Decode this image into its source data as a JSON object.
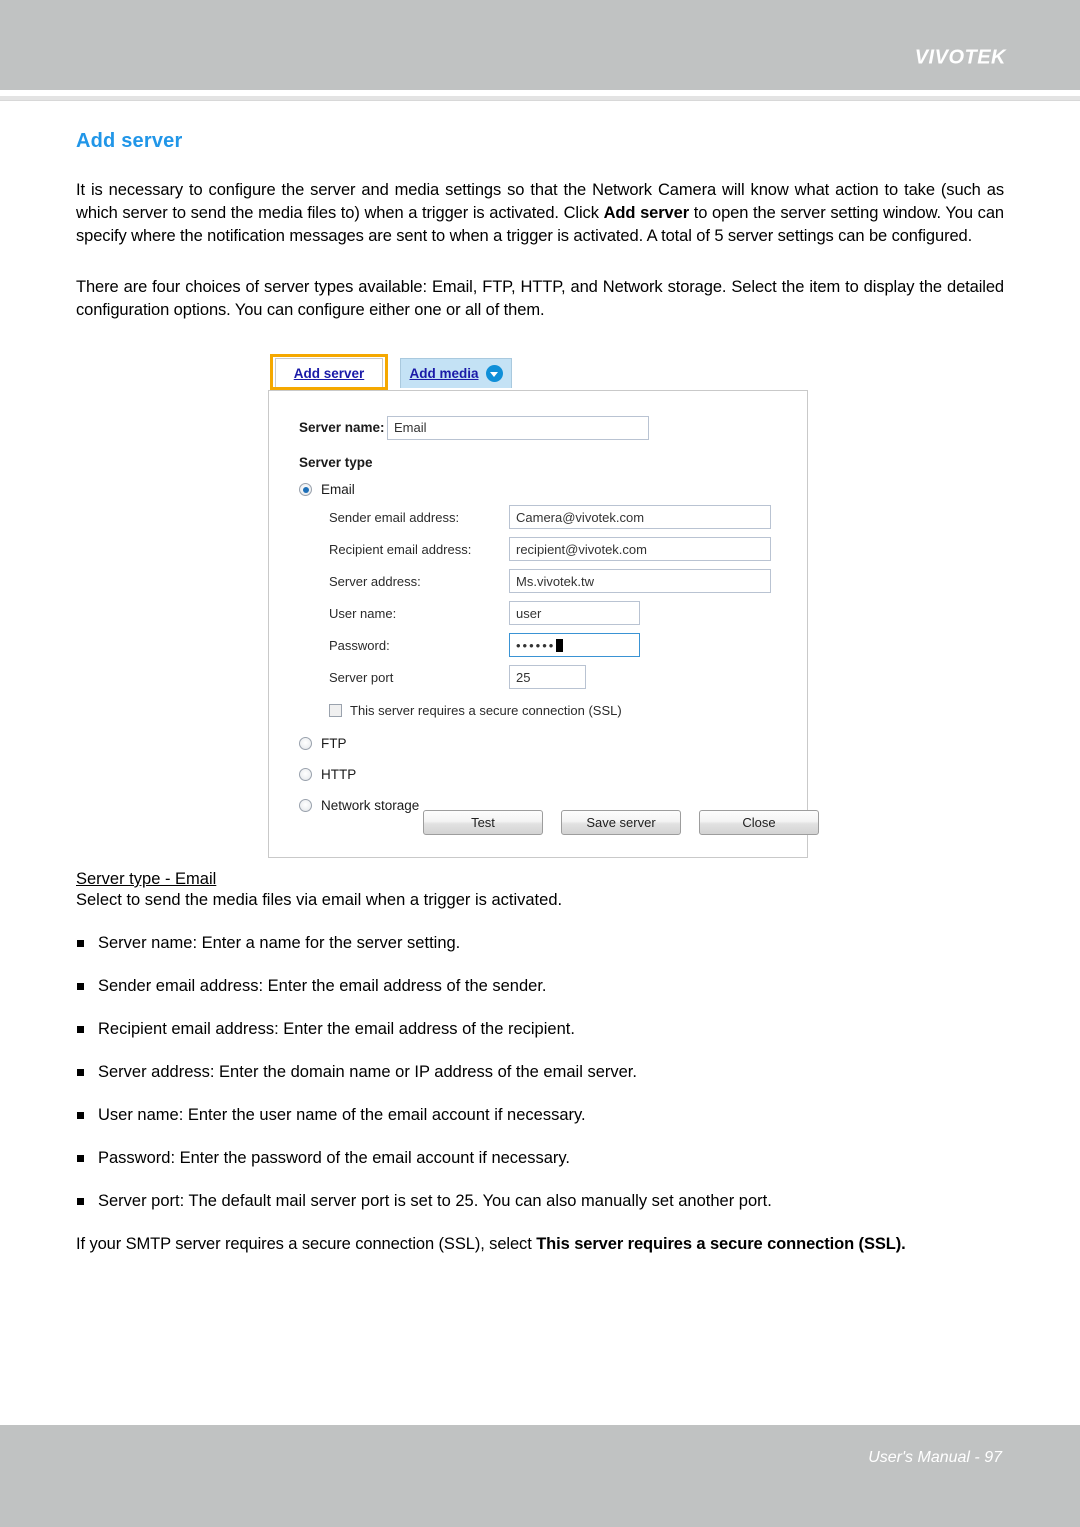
{
  "header": {
    "brand": "VIVOTEK"
  },
  "footer": {
    "text": "User's Manual - 97"
  },
  "page": {
    "title": "Add server",
    "paragraph_1_a": "It is necessary to configure the server and media settings so that the Network Camera will know what action to take (such as which server to send the media files to) when a trigger is activated. Click ",
    "paragraph_1_b": "Add server",
    "paragraph_1_c": " to open the server setting window. You can specify where the notification messages are sent to when a trigger is activated. A total of 5 server settings can be configured.",
    "paragraph_2": "There are four choices of server types available: Email, FTP, HTTP, and Network storage. Select the item to display the detailed configuration options. You can configure either one or all of them.",
    "subhead": "Server type - Email",
    "subline": "Select to send the media files via email when a trigger is activated.",
    "bullets": [
      "Server name: Enter a name for the server setting.",
      "Sender email address: Enter the email address of the sender.",
      "Recipient email address: Enter the email address of the recipient.",
      "Server address: Enter the domain name or IP address of the email server.",
      "User name: Enter the user name of the email account if necessary.",
      "Password: Enter the password of the email account if necessary.",
      "Server port: The default mail server port is set to 25. You can also manually set another port."
    ],
    "closing_a": "If your SMTP server requires a secure connection (SSL), select ",
    "closing_b": "This server requires a secure connection (SSL)."
  },
  "dialog": {
    "tabs": [
      {
        "label": "Add server",
        "selected": true,
        "highlighted": true
      },
      {
        "label": "Add media",
        "selected": false,
        "has_dropdown": true
      }
    ],
    "server_name_label": "Server name:",
    "server_name_value": "Email",
    "server_type_label": "Server type",
    "types": [
      {
        "label": "Email",
        "selected": true
      },
      {
        "label": "FTP",
        "selected": false
      },
      {
        "label": "HTTP",
        "selected": false
      },
      {
        "label": "Network storage",
        "selected": false
      }
    ],
    "fields": [
      {
        "label": "Sender email address:",
        "value": "Camera@vivotek.com"
      },
      {
        "label": "Recipient email address:",
        "value": "recipient@vivotek.com"
      },
      {
        "label": "Server address:",
        "value": "Ms.vivotek.tw"
      },
      {
        "label": "User name:",
        "value": "user"
      },
      {
        "label": "Password:",
        "value": "••••••"
      },
      {
        "label": "Server port",
        "value": "25"
      }
    ],
    "ssl_checkbox_label": "This server requires a secure connection (SSL)",
    "ssl_checked": false,
    "buttons": [
      {
        "label": "Test"
      },
      {
        "label": "Save server"
      },
      {
        "label": "Close"
      }
    ]
  },
  "colors": {
    "header_gray": "#c0c2c2",
    "title_blue": "#2196e8",
    "highlight_orange": "#f5a800",
    "tab_blue": "#c4e2f5",
    "link_blue": "#1a1aa8"
  }
}
